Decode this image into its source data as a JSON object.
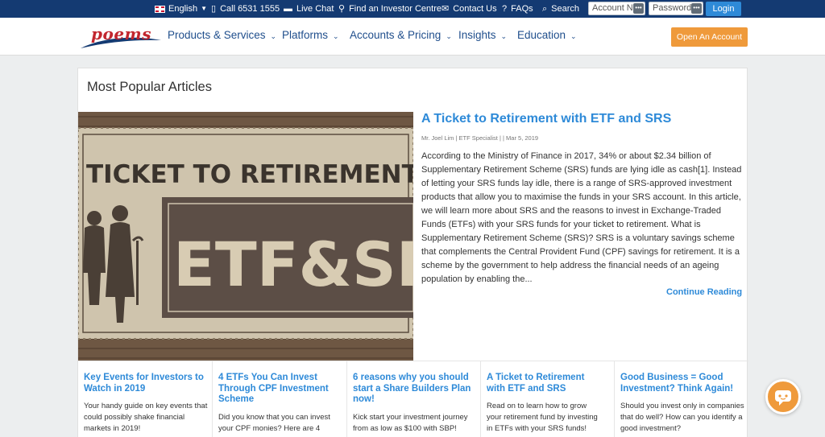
{
  "topbar": {
    "language": "English",
    "call": "Call 6531 1555",
    "live_chat": "Live Chat",
    "find_centre": "Find an Investor Centre",
    "contact": "Contact Us",
    "faqs": "FAQs",
    "search": "Search",
    "account_placeholder": "Account No",
    "password_placeholder": "Password",
    "login": "Login"
  },
  "nav": {
    "logo": "poems",
    "items": [
      "Products & Services",
      "Platforms",
      "Accounts & Pricing",
      "Insights",
      "Education"
    ],
    "open_account": "Open An Account"
  },
  "section": {
    "title": "Most Popular Articles"
  },
  "featured": {
    "title": "A Ticket to Retirement with ETF and SRS",
    "meta": "Mr. Joel Lim | ETF Specialist |  | Mar 5, 2019",
    "body": "According to the Ministry of Finance in 2017, 34% or about $2.34 billion of Supplementary Retirement Scheme (SRS) funds are lying idle as cash[1]. Instead of letting your SRS funds lay idle, there is a range of SRS-approved investment products that allow you to maximise the funds in your SRS account. In this article, we will learn more about SRS and the reasons to invest in Exchange-Traded Funds (ETFs) with your SRS funds for your ticket to retirement. What is Supplementary Retirement Scheme (SRS)? SRS is a voluntary savings scheme that complements the Central Provident Fund (CPF) savings for retirement. It is a scheme by the government to help address the financial needs of an ageing population by enabling the...",
    "continue": "Continue Reading",
    "image_text_top": "TICKET TO RETIREMENT WIT",
    "image_text_main": "ETF&SRS"
  },
  "articles": [
    {
      "title": "Key Events for Investors to Watch in 2019",
      "desc": "Your handy guide on key events that could possibly shake financial markets in 2019!"
    },
    {
      "title": "4 ETFs You Can Invest Through CPF Investment Scheme",
      "desc": "Did you know that you can invest your CPF monies? Here are 4"
    },
    {
      "title": "6 reasons why you should start a Share Builders Plan now!",
      "desc": "Kick start your investment journey from as low as $100 with SBP!"
    },
    {
      "title": "A Ticket to Retirement with ETF and SRS",
      "desc": "Read on to learn how to grow your retirement fund by investing in ETFs with your SRS funds!"
    },
    {
      "title": "Good Business = Good Investment? Think Again!",
      "desc": "Should you invest only in companies that do well? How can you identify a good investment?"
    }
  ],
  "colors": {
    "topbar": "#143a72",
    "nav_text": "#1f4e8c",
    "link": "#2e8ad8",
    "cta": "#ef9a3b",
    "logo": "#c2262e"
  },
  "icons": {
    "chat": "chat-bubble-icon"
  }
}
